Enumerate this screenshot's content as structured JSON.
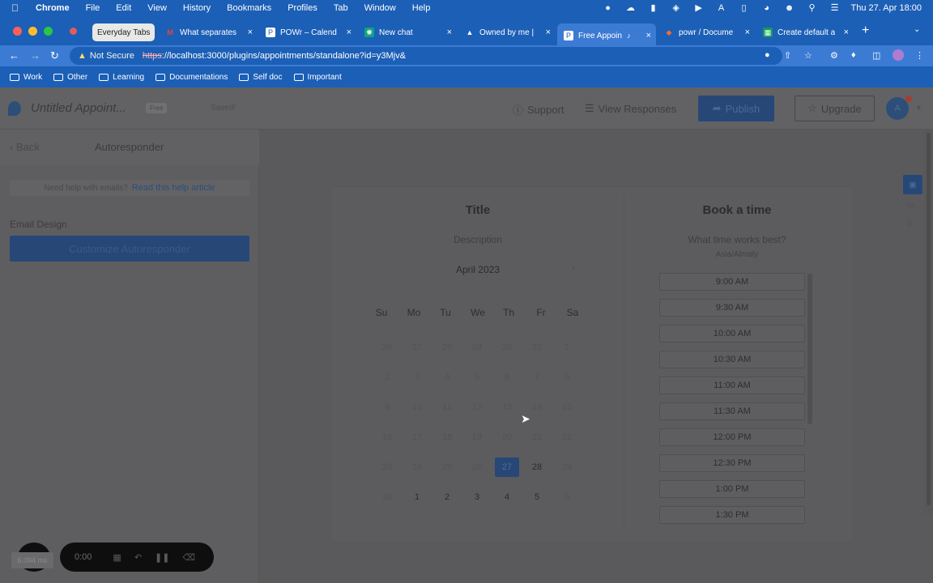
{
  "menubar": {
    "app": "Chrome",
    "items": [
      "File",
      "Edit",
      "View",
      "History",
      "Bookmarks",
      "Profiles",
      "Tab",
      "Window",
      "Help"
    ],
    "clock": "Thu 27. Apr  18:00"
  },
  "tabs": {
    "group": "Everyday Tabs",
    "items": [
      {
        "label": "What separates"
      },
      {
        "label": "POWr – Calend"
      },
      {
        "label": "New chat"
      },
      {
        "label": "Owned by me |"
      },
      {
        "label": "Free Appoin"
      },
      {
        "label": "powr / Docume"
      },
      {
        "label": "Create default a"
      }
    ]
  },
  "address": {
    "security": "Not Secure",
    "url_scheme": "https",
    "url_rest": "://localhost:3000/plugins/appointments/standalone?id=y3Mjv&"
  },
  "bookmarks": [
    "Work",
    "Other",
    "Learning",
    "Documentations",
    "Self doc",
    "Important"
  ],
  "header": {
    "title": "Untitled Appoint...",
    "badge": "Free",
    "saved": "Saved!",
    "support": "Support",
    "responses": "View Responses",
    "publish": "Publish",
    "upgrade": "Upgrade",
    "avatar": "A"
  },
  "sidebar": {
    "back": "Back",
    "title": "Autoresponder",
    "help_text": "Need help with emails?",
    "help_link": "Read this help article",
    "section": "Email Design",
    "customize": "Customize Autoresponder"
  },
  "preview": {
    "title": "Title",
    "description": "Description",
    "month": "April 2023",
    "weekdays": [
      "Su",
      "Mo",
      "Tu",
      "We",
      "Th",
      "Fr",
      "Sa"
    ],
    "weeks": [
      [
        "26",
        "27",
        "28",
        "29",
        "30",
        "31",
        "1"
      ],
      [
        "2",
        "3",
        "4",
        "5",
        "6",
        "7",
        "8"
      ],
      [
        "9",
        "10",
        "11",
        "12",
        "13",
        "14",
        "15"
      ],
      [
        "16",
        "17",
        "18",
        "19",
        "20",
        "21",
        "22"
      ],
      [
        "23",
        "24",
        "25",
        "26",
        "27",
        "28",
        "29"
      ],
      [
        "30",
        "1",
        "2",
        "3",
        "4",
        "5",
        "6"
      ]
    ],
    "book_title": "Book a time",
    "book_question": "What time works best?",
    "timezone": "Asia/Almaty",
    "slots": [
      "9:00 AM",
      "9:30 AM",
      "10:00 AM",
      "10:30 AM",
      "11:00 AM",
      "11:30 AM",
      "12:00 PM",
      "12:30 PM",
      "1:00 PM",
      "1:30 PM"
    ]
  },
  "recorder": {
    "time": "0:00",
    "badge": "6.094 ms"
  }
}
